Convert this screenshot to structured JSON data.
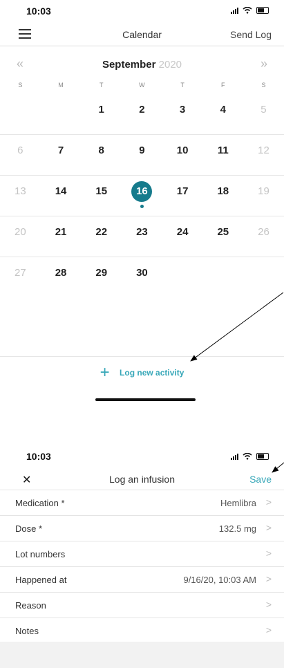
{
  "top_screen": {
    "status": {
      "time": "10:03"
    },
    "nav": {
      "title": "Calendar",
      "send_log": "Send Log",
      "menu_icon": "hamburger-icon"
    },
    "month_bar": {
      "prev_icon": "«",
      "next_icon": "»",
      "month": "September",
      "year": "2020"
    },
    "weekdays": [
      "S",
      "M",
      "T",
      "W",
      "T",
      "F",
      "S"
    ],
    "weeks": [
      [
        "",
        "",
        "1",
        "2",
        "3",
        "4",
        "5"
      ],
      [
        "6",
        "7",
        "8",
        "9",
        "10",
        "11",
        "12"
      ],
      [
        "13",
        "14",
        "15",
        "16",
        "17",
        "18",
        "19"
      ],
      [
        "20",
        "21",
        "22",
        "23",
        "24",
        "25",
        "26"
      ],
      [
        "27",
        "28",
        "29",
        "30",
        "",
        "",
        ""
      ]
    ],
    "selected_day": "16",
    "log_button": {
      "plus": "+",
      "label": "Log new activity"
    }
  },
  "bottom_screen": {
    "status": {
      "time": "10:03"
    },
    "nav": {
      "close": "✕",
      "title": "Log an infusion",
      "save": "Save"
    },
    "fields": [
      {
        "label": "Medication *",
        "value": "Hemlibra"
      },
      {
        "label": "Dose *",
        "value": "132.5 mg"
      },
      {
        "label": "Lot numbers",
        "value": ""
      },
      {
        "label": "Happened at",
        "value": "9/16/20, 10:03 AM"
      },
      {
        "label": "Reason",
        "value": ""
      },
      {
        "label": "Notes",
        "value": ""
      }
    ],
    "chevron": ">"
  },
  "colors": {
    "accent": "#37a7b8",
    "selected": "#167b8c"
  }
}
